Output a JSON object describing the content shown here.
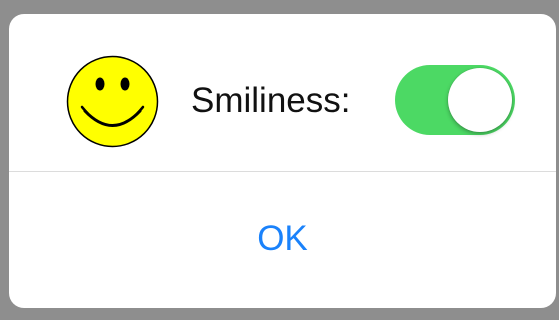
{
  "alert": {
    "icon": "smiley-face-icon",
    "label": "Smiliness:",
    "toggle": {
      "state": "on",
      "on_color": "#4cd964"
    },
    "ok_button": {
      "label": "OK",
      "color": "#1a82fb"
    }
  }
}
